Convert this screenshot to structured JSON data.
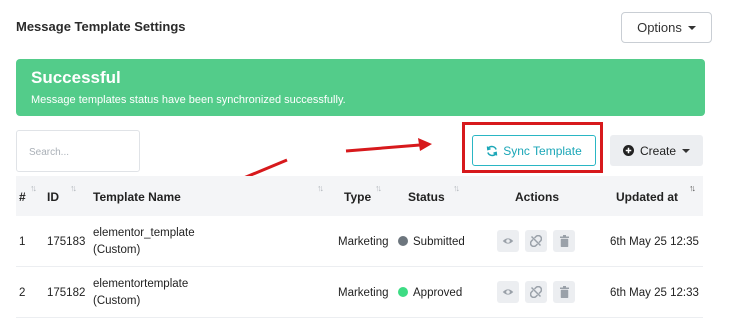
{
  "header": {
    "title": "Message Template Settings",
    "options_label": "Options"
  },
  "alert": {
    "title": "Successful",
    "message": "Message templates status have been synchronized successfully."
  },
  "toolbar": {
    "search_placeholder": "Search...",
    "sync_label": "Sync Template",
    "create_label": "Create"
  },
  "table": {
    "columns": [
      "#",
      "ID",
      "Template Name",
      "Type",
      "Status",
      "Actions",
      "Updated at"
    ],
    "rows": [
      {
        "num": "1",
        "id": "175183",
        "name": "elementor_template",
        "sub": "(Custom)",
        "type": "Marketing",
        "status": "Submitted",
        "updated": "6th May 25 12:35"
      },
      {
        "num": "2",
        "id": "175182",
        "name": "elementortemplate",
        "sub": "(Custom)",
        "type": "Marketing",
        "status": "Approved",
        "updated": "6th May 25 12:33"
      }
    ]
  },
  "colors": {
    "success": "#53cc8a",
    "accent": "#1aa6b7",
    "annotation": "#d7191c",
    "status_submitted": "#6c757d",
    "status_approved": "#3ddc84"
  },
  "icons": [
    "sync-icon",
    "plus-circle-icon",
    "eye-icon",
    "unlink-icon",
    "trash-icon",
    "sort-icon"
  ]
}
